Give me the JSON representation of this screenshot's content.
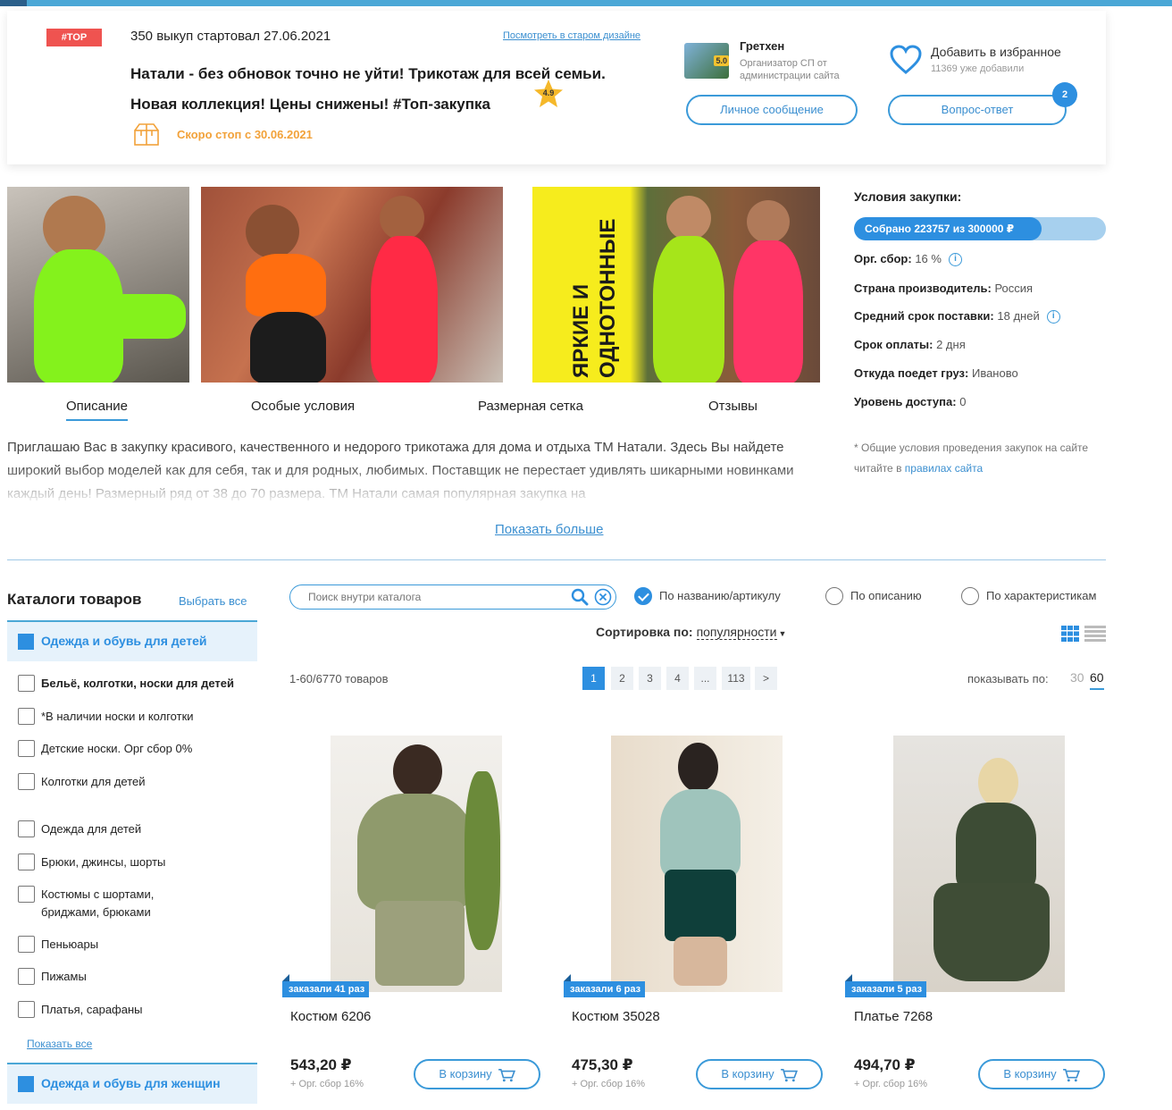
{
  "header": {
    "badge": "#TOP",
    "started": "350 выкуп стартовал 27.06.2021",
    "old_design_link": "Посмотреть в старом дизайне",
    "title_line1": "Натали - без обновок точно не уйти! Трикотаж для всей семьи.",
    "title_line2": "Новая коллекция! Цены снижены! #Топ-закупка",
    "rating": "4.9",
    "soon_stop": "Скоро стоп с 30.06.2021"
  },
  "organizer": {
    "rating": "5.0",
    "name": "Гретхен",
    "role": "Организатор СП от администрации сайта",
    "message_button": "Личное сообщение"
  },
  "favorites": {
    "title": "Добавить в избранное",
    "count": "11369 уже добавили",
    "qa_button": "Вопрос-ответ",
    "qa_badge": "2"
  },
  "gallery": {
    "banner_text": "ЯРКИЕ И ОДНОТОННЫЕ"
  },
  "tabs": [
    {
      "label": "Описание",
      "active": true
    },
    {
      "label": "Особые условия",
      "active": false
    },
    {
      "label": "Размерная сетка",
      "active": false
    },
    {
      "label": "Отзывы",
      "active": false
    }
  ],
  "description": {
    "text": "Приглашаю Вас в закупку красивого, качественного и недорого трикотажа для дома и отдыха ТМ Натали. Здесь Вы найдете широкий выбор моделей как для себя, так и для родных, любимых. Поставщик не перестает удивлять шикарными новинками каждый день! Размерный ряд от 38 до 70 размера. ТМ Натали самая популярная закупка на",
    "show_more": "Показать больше"
  },
  "conditions": {
    "title": "Условия закупки:",
    "progress_text": "Собрано 223757 из 300000 ₽",
    "progress_fraction": 0.746,
    "rows": [
      {
        "label": "Орг. сбор:",
        "value": "16 %",
        "info": true
      },
      {
        "label": "Страна производитель:",
        "value": "Россия",
        "info": false
      },
      {
        "label": "Средний срок поставки:",
        "value": "18 дней",
        "info": true
      },
      {
        "label": "Срок оплаты:",
        "value": "2 дня",
        "info": false
      },
      {
        "label": "Откуда поедет груз:",
        "value": "Иваново",
        "info": false
      },
      {
        "label": "Уровень доступа:",
        "value": "0",
        "info": false
      }
    ],
    "note_text": "* Общие условия проведения закупок на сайте читайте в",
    "note_link": "правилах сайта"
  },
  "catalog": {
    "title": "Каталоги товаров",
    "select_all": "Выбрать все",
    "group_children": "Одежда и обувь для детей",
    "items": [
      "Бельё, колготки, носки для детей",
      "*В наличии носки и колготки",
      "Детские носки. Орг сбор 0%",
      "Колготки для детей",
      "Одежда для детей",
      "Брюки, джинсы, шорты",
      "Костюмы с шортами, бриджами, брюками",
      "Пеньюары",
      "Пижамы",
      "Платья, сарафаны"
    ],
    "show_all": "Показать все",
    "group_women": "Одежда и обувь для женщин"
  },
  "search": {
    "placeholder": "Поиск внутри каталога",
    "filters": [
      {
        "label": "По названию/артикулу",
        "checked": true
      },
      {
        "label": "По описанию",
        "checked": false
      },
      {
        "label": "По характеристикам",
        "checked": false
      }
    ]
  },
  "sorting": {
    "label": "Сортировка по:",
    "value": "популярности"
  },
  "listing": {
    "count": "1-60/6770 товаров",
    "pages": [
      "1",
      "2",
      "3",
      "4",
      "...",
      "113",
      ">"
    ],
    "active_page": "1",
    "per_page_label": "показывать по:",
    "per_page_options": [
      "30",
      "60"
    ],
    "per_page_selected": "60"
  },
  "products": [
    {
      "badge": "заказали 41 раз",
      "name": "Костюм 6206",
      "price": "543,20 ₽",
      "fee": "+ Орг. сбор 16%",
      "cart": "В корзину"
    },
    {
      "badge": "заказали 6 раз",
      "name": "Костюм 35028",
      "price": "475,30 ₽",
      "fee": "+ Орг. сбор 16%",
      "cart": "В корзину"
    },
    {
      "badge": "заказали 5 раз",
      "name": "Платье 7268",
      "price": "494,70 ₽",
      "fee": "+ Орг. сбор 16%",
      "cart": "В корзину"
    }
  ],
  "colors": {
    "accent": "#2d8fe0",
    "badge_red": "#ef5350",
    "soon_orange": "#f2a23a",
    "progress_track": "#a7d0ee"
  }
}
